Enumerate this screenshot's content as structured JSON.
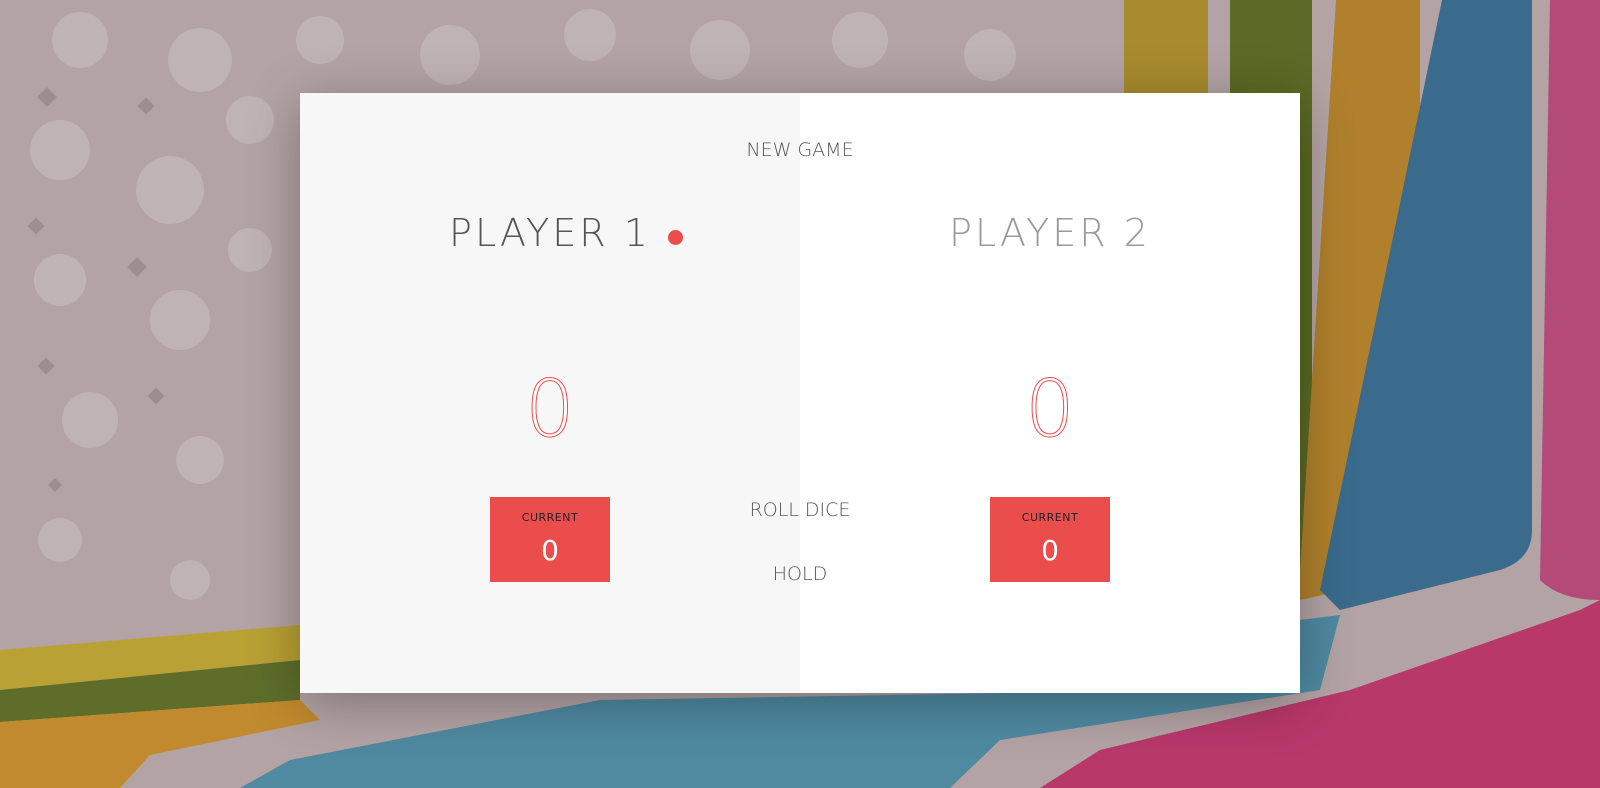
{
  "buttons": {
    "new_game": "NEW GAME",
    "roll_dice": "ROLL DICE",
    "hold": "HOLD"
  },
  "players": [
    {
      "name": "PLAYER 1",
      "score": "0",
      "current_label": "CURRENT",
      "current_score": "0",
      "active": true
    },
    {
      "name": "PLAYER 2",
      "score": "0",
      "current_label": "CURRENT",
      "current_score": "0",
      "active": false
    }
  ],
  "colors": {
    "accent": "#eb4d4d",
    "panel_active": "#f7f7f7",
    "panel_inactive": "#ffffff",
    "background": "#b3a3a4"
  }
}
